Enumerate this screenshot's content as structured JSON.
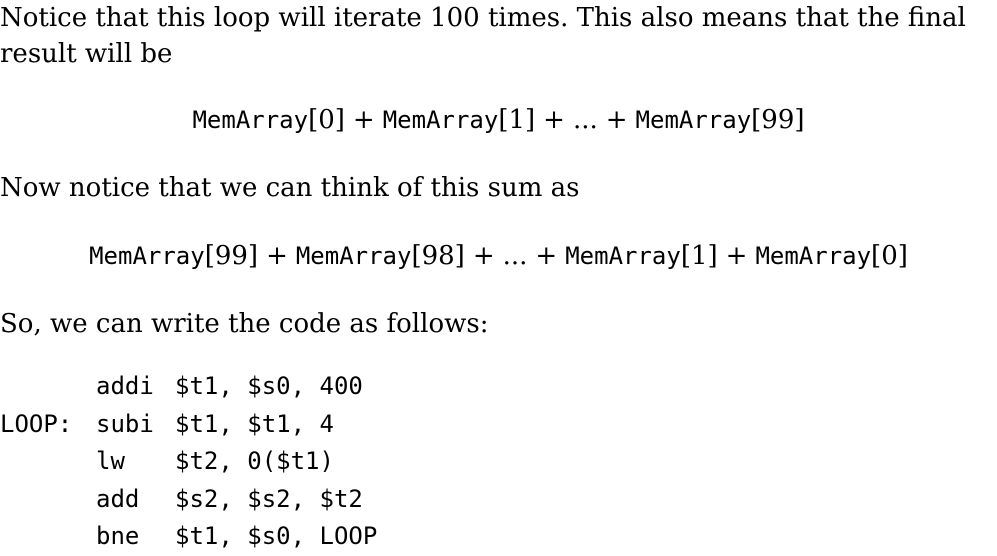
{
  "paragraphs": {
    "intro_line1": "Notice that this loop will iterate 100 times. This also means that the final",
    "intro_line2": "result will be",
    "reverse": "Now notice that we can think of this sum as",
    "code_intro": "So, we can write the code as follows:"
  },
  "equation1": {
    "t1": "MemArray",
    "i1": "[0]",
    "t2": "MemArray",
    "i2": "[1]",
    "ellipsis": "...",
    "t3": "MemArray",
    "i3": "[99]",
    "plus": "+"
  },
  "equation2": {
    "t1": "MemArray",
    "i1": "[99]",
    "t2": "MemArray",
    "i2": "[98]",
    "ellipsis": "...",
    "t3": "MemArray",
    "i3": "[1]",
    "t4": "MemArray",
    "i4": "[0]",
    "plus": "+"
  },
  "code": [
    {
      "label": "",
      "op": "addi",
      "args": "$t1, $s0, 400"
    },
    {
      "label": "LOOP:",
      "op": "subi",
      "args": "$t1, $t1, 4"
    },
    {
      "label": "",
      "op": "lw",
      "args": "$t2, 0($t1)"
    },
    {
      "label": "",
      "op": "add",
      "args": "$s2, $s2, $t2"
    },
    {
      "label": "",
      "op": "bne",
      "args": "$t1, $s0, LOOP"
    }
  ]
}
